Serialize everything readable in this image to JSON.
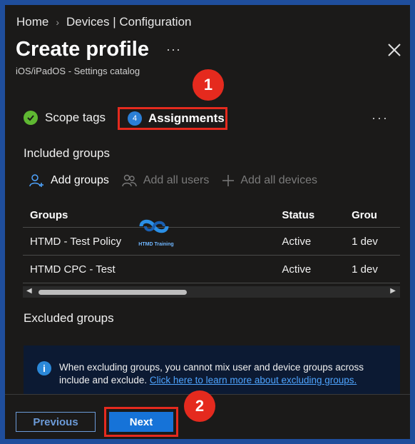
{
  "breadcrumb": {
    "home": "Home",
    "current": "Devices | Configuration"
  },
  "header": {
    "title": "Create profile",
    "more": "···",
    "subtitle": "iOS/iPadOS - Settings catalog"
  },
  "markers": {
    "one": "1",
    "two": "2"
  },
  "steps": {
    "scope_tags": "Scope tags",
    "assignments_number": "4",
    "assignments": "Assignments",
    "more": "···"
  },
  "included": {
    "heading": "Included groups",
    "actions": {
      "add_groups": "Add groups",
      "add_all_users": "Add all users",
      "add_all_devices": "Add all devices"
    },
    "table": {
      "headers": [
        "Groups",
        "Status",
        "Grou"
      ],
      "rows": [
        [
          "HTMD - Test Policy",
          "Active",
          "1 dev"
        ],
        [
          "HTMD CPC - Test",
          "Active",
          "1 dev"
        ]
      ]
    }
  },
  "watermark": {
    "text": "HTMD Training"
  },
  "excluded": {
    "heading": "Excluded groups",
    "info_text": "When excluding groups, you cannot mix user and device groups across include and exclude.",
    "info_link": "Click here to learn more about excluding groups."
  },
  "footer": {
    "previous": "Previous",
    "next": "Next"
  },
  "colors": {
    "accent": "#1673d8",
    "highlight": "#e52a1e",
    "success": "#5fb832",
    "background": "#1b1a19"
  }
}
